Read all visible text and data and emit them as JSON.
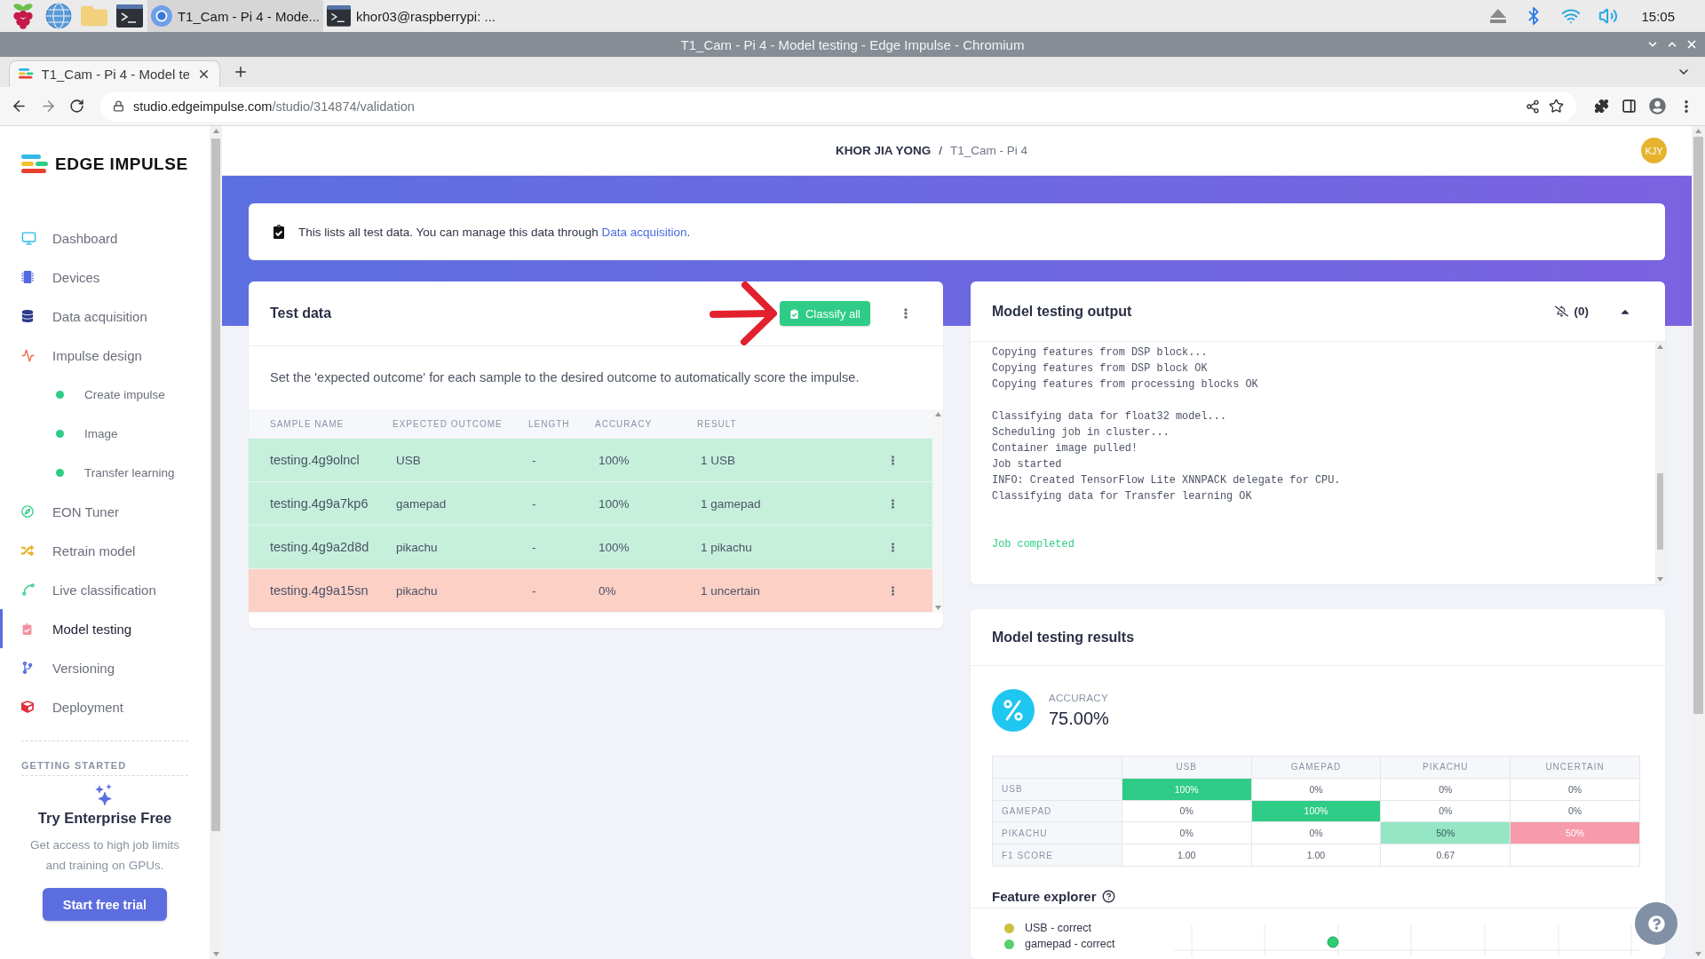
{
  "taskbar": {
    "tasks": [
      {
        "kind": "browser",
        "label": "T1_Cam - Pi 4 - Mode...",
        "selected": true
      },
      {
        "kind": "terminal",
        "label": "khor03@raspberrypi: ...",
        "selected": false
      }
    ],
    "clock": "15:05"
  },
  "window": {
    "title": "T1_Cam - Pi 4 - Model testing - Edge Impulse - Chromium"
  },
  "browser": {
    "tab": {
      "title": "T1_Cam - Pi 4 - Model te"
    },
    "url": {
      "host": "studio.edgeimpulse.com",
      "path": "/studio/314874/validation"
    }
  },
  "sidebar": {
    "brand": "EDGE IMPULSE",
    "items": [
      {
        "label": "Dashboard",
        "selected": false
      },
      {
        "label": "Devices",
        "selected": false
      },
      {
        "label": "Data acquisition",
        "selected": false
      },
      {
        "label": "Impulse design",
        "selected": false,
        "children": [
          {
            "label": "Create impulse",
            "selected": false
          },
          {
            "label": "Image",
            "selected": false
          },
          {
            "label": "Transfer learning",
            "selected": false
          }
        ]
      },
      {
        "label": "EON Tuner",
        "selected": false
      },
      {
        "label": "Retrain model",
        "selected": false
      },
      {
        "label": "Live classification",
        "selected": false
      },
      {
        "label": "Model testing",
        "selected": true
      },
      {
        "label": "Versioning",
        "selected": false
      },
      {
        "label": "Deployment",
        "selected": false
      }
    ],
    "getting_started": {
      "heading": "GETTING STARTED",
      "title": "Try Enterprise Free",
      "text": "Get access to high job limits and training on GPUs.",
      "button": "Start free trial"
    }
  },
  "header": {
    "owner": "KHOR JIA YONG",
    "separator": "/",
    "project": "T1_Cam - Pi 4",
    "avatar": "KJY"
  },
  "notice": {
    "text": "This lists all test data. You can manage this data through ",
    "link": "Data acquisition",
    "end": "."
  },
  "test_data": {
    "title": "Test data",
    "classify_button": "Classify all",
    "description": "Set the 'expected outcome' for each sample to the desired outcome to automatically score the impulse.",
    "columns": [
      "SAMPLE NAME",
      "EXPECTED OUTCOME",
      "LENGTH",
      "ACCURACY",
      "RESULT"
    ],
    "rows": [
      {
        "sample_name": "testing.4g9olncl",
        "expected_outcome": "USB",
        "length": "-",
        "accuracy": "100%",
        "result": "1 USB",
        "correct": true
      },
      {
        "sample_name": "testing.4g9a7kp6",
        "expected_outcome": "gamepad",
        "length": "-",
        "accuracy": "100%",
        "result": "1 gamepad",
        "correct": true
      },
      {
        "sample_name": "testing.4g9a2d8d",
        "expected_outcome": "pikachu",
        "length": "-",
        "accuracy": "100%",
        "result": "1 pikachu",
        "correct": true
      },
      {
        "sample_name": "testing.4g9a15sn",
        "expected_outcome": "pikachu",
        "length": "-",
        "accuracy": "0%",
        "result": "1 uncertain",
        "correct": false
      }
    ]
  },
  "model_testing_output": {
    "title": "Model testing output",
    "notifications": "(0)",
    "log_blocks": [
      {
        "kind": "info",
        "lines": [
          "Copying features from DSP block...",
          "Copying features from DSP block OK",
          "Copying features from processing blocks OK"
        ]
      },
      {
        "kind": "info",
        "lines": [
          "Classifying data for float32 model...",
          "Scheduling job in cluster...",
          "Container image pulled!",
          "Job started",
          "INFO: Created TensorFlow Lite XNNPACK delegate for CPU.",
          "Classifying data for Transfer learning OK"
        ]
      },
      {
        "kind": "success",
        "lines": [
          "Job completed"
        ]
      }
    ]
  },
  "model_testing_results": {
    "title": "Model testing results",
    "accuracy": {
      "label": "ACCURACY",
      "value": "75.00%"
    },
    "matrix": {
      "columns": [
        "USB",
        "GAMEPAD",
        "PIKACHU",
        "UNCERTAIN"
      ],
      "rows": [
        {
          "label": "USB",
          "cells": [
            {
              "value": "100%",
              "kind": "hit"
            },
            {
              "value": "0%",
              "kind": "plain"
            },
            {
              "value": "0%",
              "kind": "plain"
            },
            {
              "value": "0%",
              "kind": "plain"
            }
          ]
        },
        {
          "label": "GAMEPAD",
          "cells": [
            {
              "value": "0%",
              "kind": "plain"
            },
            {
              "value": "100%",
              "kind": "hit"
            },
            {
              "value": "0%",
              "kind": "plain"
            },
            {
              "value": "0%",
              "kind": "plain"
            }
          ]
        },
        {
          "label": "PIKACHU",
          "cells": [
            {
              "value": "0%",
              "kind": "plain"
            },
            {
              "value": "0%",
              "kind": "plain"
            },
            {
              "value": "50%",
              "kind": "partial"
            },
            {
              "value": "50%",
              "kind": "miss"
            }
          ]
        }
      ],
      "f1": {
        "label": "F1 SCORE",
        "values": [
          "1.00",
          "1.00",
          "0.67"
        ]
      }
    },
    "feature_explorer": {
      "title": "Feature explorer",
      "legend": [
        {
          "label": "USB - correct",
          "color": "#c9c13a"
        },
        {
          "label": "gamepad - correct",
          "color": "#5ccf6a"
        }
      ]
    }
  }
}
